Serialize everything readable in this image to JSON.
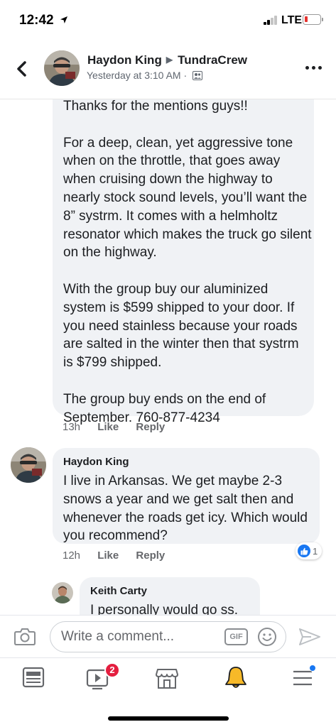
{
  "status_bar": {
    "time": "12:42",
    "network": "LTE",
    "icons": [
      "location-arrow-icon",
      "signal-bars-icon",
      "battery-low-icon"
    ]
  },
  "header": {
    "author": "Haydon King",
    "group": "TundraCrew",
    "timestamp": "Yesterday at 3:10 AM ·",
    "icons": [
      "back-chevron-icon",
      "group-privacy-icon",
      "more-dots-icon"
    ]
  },
  "comments": [
    {
      "text": "Thanks for the mentions guys!!\n\nFor a deep, clean, yet aggressive tone when on the throttle, that goes away when cruising down the highway to nearly stock sound levels, you’ll want the 8” systrm. It comes with a helmholtz resonator which makes the truck go silent on the highway.\n\nWith the group buy our aluminized system is $599 shipped to your door. If you need stainless because your roads are salted in the winter then that systrm is $799 shipped.\n\nThe group buy ends on the end of September. 760-877-4234",
      "time": "13h",
      "like_label": "Like",
      "reply_label": "Reply"
    },
    {
      "author": "Haydon King",
      "text": "I live in Arkansas. We get maybe 2-3 snows a year and we get salt then and whenever the roads get icy. Which would you recommend?",
      "time": "12h",
      "like_label": "Like",
      "reply_label": "Reply",
      "reaction_count": "1"
    },
    {
      "author": "Keith Carty",
      "text": "I personally would go ss."
    }
  ],
  "composer": {
    "placeholder": "Write a comment...",
    "gif_label": "GIF",
    "icons": [
      "camera-icon",
      "emoji-icon",
      "send-icon"
    ]
  },
  "tabbar": {
    "watch_badge": "2",
    "icons": [
      "news-feed-icon",
      "watch-icon",
      "marketplace-icon",
      "notifications-bell-icon",
      "menu-icon"
    ],
    "accent": "#1877f2",
    "badge_color": "#e41e3f",
    "bell_color": "#f7b928"
  }
}
